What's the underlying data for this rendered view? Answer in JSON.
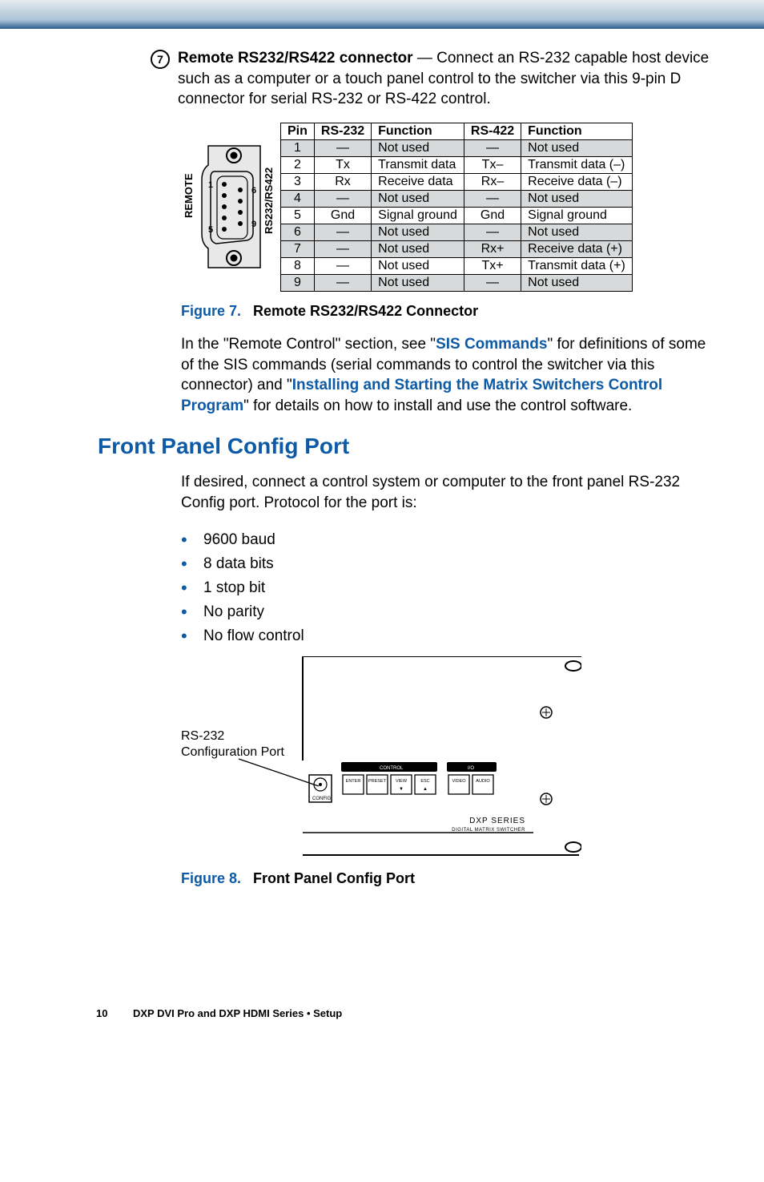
{
  "item7": {
    "num": "7",
    "title": "Remote RS232/RS422 connector",
    "sep": " — ",
    "rest": "Connect an RS-232 capable host device such as a computer or a touch panel control to the switcher via this 9-pin D connector for serial RS-232 or RS-422 control."
  },
  "conn_labels": {
    "remote": "REMOTE",
    "rs": "RS232/RS422",
    "p1": "1",
    "p5": "5",
    "p6": "6",
    "p9": "9"
  },
  "table": {
    "headers": [
      "Pin",
      "RS-232",
      "Function",
      "RS-422",
      "Function"
    ],
    "rows": [
      {
        "shade": true,
        "c": [
          "1",
          "—",
          "Not used",
          "—",
          "Not used"
        ]
      },
      {
        "shade": false,
        "c": [
          "2",
          "Tx",
          "Transmit data",
          "Tx–",
          "Transmit data (–)"
        ]
      },
      {
        "shade": false,
        "c": [
          "3",
          "Rx",
          "Receive data",
          "Rx–",
          "Receive data (–)"
        ]
      },
      {
        "shade": true,
        "c": [
          "4",
          "—",
          "Not used",
          "—",
          "Not used"
        ]
      },
      {
        "shade": false,
        "c": [
          "5",
          "Gnd",
          "Signal ground",
          "Gnd",
          "Signal ground"
        ]
      },
      {
        "shade": true,
        "c": [
          "6",
          "—",
          "Not used",
          "—",
          "Not used"
        ]
      },
      {
        "shade": true,
        "c": [
          "7",
          "—",
          "Not used",
          "Rx+",
          "Receive data (+)"
        ]
      },
      {
        "shade": false,
        "c": [
          "8",
          "—",
          "Not used",
          "Tx+",
          "Transmit data (+)"
        ]
      },
      {
        "shade": true,
        "c": [
          "9",
          "—",
          "Not used",
          "—",
          "Not used"
        ]
      }
    ]
  },
  "fig7": {
    "label": "Figure 7.",
    "title": "Remote RS232/RS422 Connector"
  },
  "para1": {
    "a": "In the \"Remote Control\" section, see \"",
    "link1": "SIS Commands",
    "b": "\" for definitions of some of the SIS commands (serial commands to control the switcher via this connector) and \"",
    "link2": "Installing and Starting the Matrix Switchers Control Program",
    "c": "\" for details on how to install and use the control software."
  },
  "section": "Front Panel Config Port",
  "para2": "If desired, connect a control system or computer to the front panel RS-232 Config port. Protocol for the port is:",
  "bullets": [
    "9600 baud",
    "8 data bits",
    "1 stop bit",
    "No parity",
    "No flow control"
  ],
  "diagram": {
    "label1": "RS-232",
    "label2": "Configuration Port",
    "config": "CONFIG",
    "control": "CONTROL",
    "io": "I/O",
    "btns": [
      "ENTER",
      "PRESET",
      "VIEW",
      "ESC",
      "VIDEO",
      "AUDIO"
    ],
    "brand1": "DXP SERIES",
    "brand2": "DIGITAL MATRIX SWITCHER"
  },
  "fig8": {
    "label": "Figure 8.",
    "title": "Front Panel Config Port"
  },
  "footer": {
    "page": "10",
    "title": "DXP DVI Pro and DXP HDMI Series • Setup"
  }
}
